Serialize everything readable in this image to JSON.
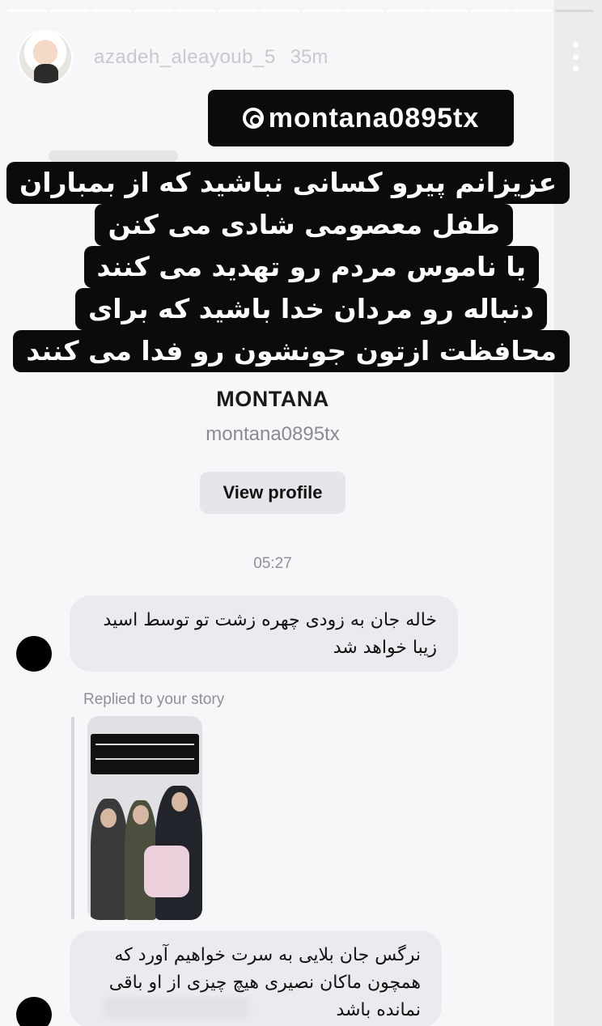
{
  "story": {
    "username": "azadeh_aleayoub_5",
    "time_ago": "35m",
    "mention": "montana0895tx",
    "caption_lines": [
      "عزیزانم پیرو کسانی نباشید که از بمباران",
      "طفل معصومی شادی می کنن",
      "یا ناموس مردم رو تهدید می کنند",
      "دنباله رو مردان خدا باشید که برای",
      "محافظت ازتون جونشون رو فدا می کنند"
    ]
  },
  "dm": {
    "profile_name": "MONTANA",
    "profile_handle": "montana0895tx",
    "view_profile_label": "View profile",
    "timestamp": "05:27",
    "message1": "خاله جان به زودی چهره زشت تو توسط اسید زیبا خواهد شد",
    "replied_label": "Replied to your story",
    "message2": "نرگس جان بلایی به سرت خواهیم آورد که همچون ماکان نصیری هیچ چیزی از او باقی نمانده باشد"
  },
  "icons": {
    "more": "more-vertical-icon",
    "threads": "threads-icon"
  },
  "colors": {
    "sticker_bg": "#0b0b0b",
    "bubble_bg": "#ebebef",
    "button_bg": "#e5e5ea"
  }
}
